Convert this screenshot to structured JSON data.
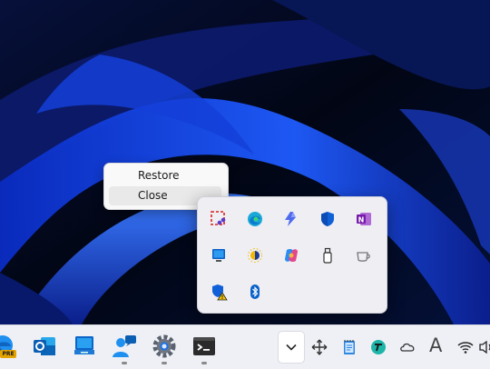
{
  "context_menu": {
    "items": [
      {
        "label": "Restore"
      },
      {
        "label": "Close"
      }
    ]
  },
  "overflow_flyout": {
    "icons": [
      "snipping-tool-icon",
      "edge-icon",
      "power-automate-icon",
      "defender-shield-icon",
      "onenote-icon",
      "monitor-icon",
      "weather-sun-icon",
      "copilot-icon",
      "usb-drive-icon",
      "cup-icon",
      "security-warning-icon",
      "bluetooth-icon"
    ]
  },
  "taskbar": {
    "pinned_apps": [
      "edge-preview-icon",
      "outlook-icon",
      "remote-desktop-icon",
      "people-chat-icon",
      "settings-icon",
      "terminal-icon"
    ],
    "badge_label": "PRE",
    "tray_icons": [
      "move-arrows-icon",
      "notepad-icon",
      "sync-app-icon",
      "onedrive-cloud-icon",
      "font-icon",
      "wifi-icon",
      "volume-icon"
    ],
    "font_icon_label": "A"
  },
  "colors": {
    "accent_blue": "#0a62c8",
    "taskbar_bg": "#eef0f5",
    "flyout_bg": "#eeeef3",
    "menu_hover": "#e9e9e9"
  }
}
